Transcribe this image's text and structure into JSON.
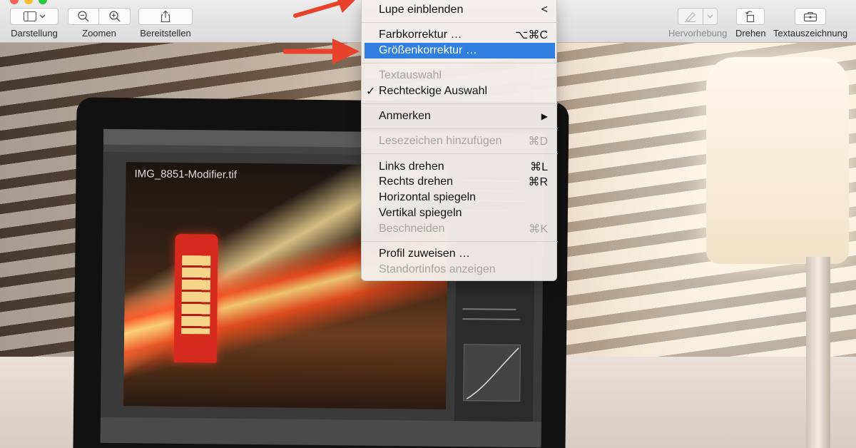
{
  "toolbar": {
    "buttons": {
      "view": {
        "label": "Darstellung",
        "icon": "sidebar-icon"
      },
      "zoom": {
        "label": "Zoomen",
        "icons": [
          "zoom-out-icon",
          "zoom-in-icon"
        ]
      },
      "share": {
        "label": "Bereitstellen",
        "icon": "share-icon"
      },
      "highlight": {
        "label": "Hervorhebung",
        "icon": "highlighter-icon",
        "disabled": true
      },
      "rotate": {
        "label": "Drehen",
        "icon": "rotate-icon"
      },
      "markup": {
        "label": "Textauszeichnung",
        "icon": "toolbox-icon"
      }
    }
  },
  "menu": {
    "items": [
      {
        "label": "Lupe einblenden",
        "shortcut": "<",
        "enabled": true
      },
      {
        "label": "Farbkorrektur …",
        "shortcut": "⌥⌘C",
        "enabled": true
      },
      {
        "label": "Größenkorrektur …",
        "shortcut": "",
        "enabled": true,
        "highlighted": true
      },
      {
        "label": "Textauswahl",
        "shortcut": "",
        "enabled": false
      },
      {
        "label": "Rechteckige Auswahl",
        "shortcut": "",
        "enabled": true,
        "checked": true
      },
      {
        "label": "Anmerken",
        "shortcut": "▶",
        "enabled": true,
        "submenu": true
      },
      {
        "label": "Lesezeichen hinzufügen",
        "shortcut": "⌘D",
        "enabled": false
      },
      {
        "label": "Links drehen",
        "shortcut": "⌘L",
        "enabled": true
      },
      {
        "label": "Rechts drehen",
        "shortcut": "⌘R",
        "enabled": true
      },
      {
        "label": "Horizontal spiegeln",
        "shortcut": "",
        "enabled": true
      },
      {
        "label": "Vertikal spiegeln",
        "shortcut": "",
        "enabled": true
      },
      {
        "label": "Beschneiden",
        "shortcut": "⌘K",
        "enabled": false
      },
      {
        "label": "Profil zuweisen …",
        "shortcut": "",
        "enabled": true
      },
      {
        "label": "Standortinfos anzeigen",
        "shortcut": "",
        "enabled": false
      }
    ],
    "checkmark": "✓"
  },
  "photo": {
    "screen_title": "IMG_8851-Modifier.tif"
  },
  "colors": {
    "highlight": "#2f7fe0",
    "arrow": "#e8412c",
    "disabled_text": "#a7a4a1"
  }
}
